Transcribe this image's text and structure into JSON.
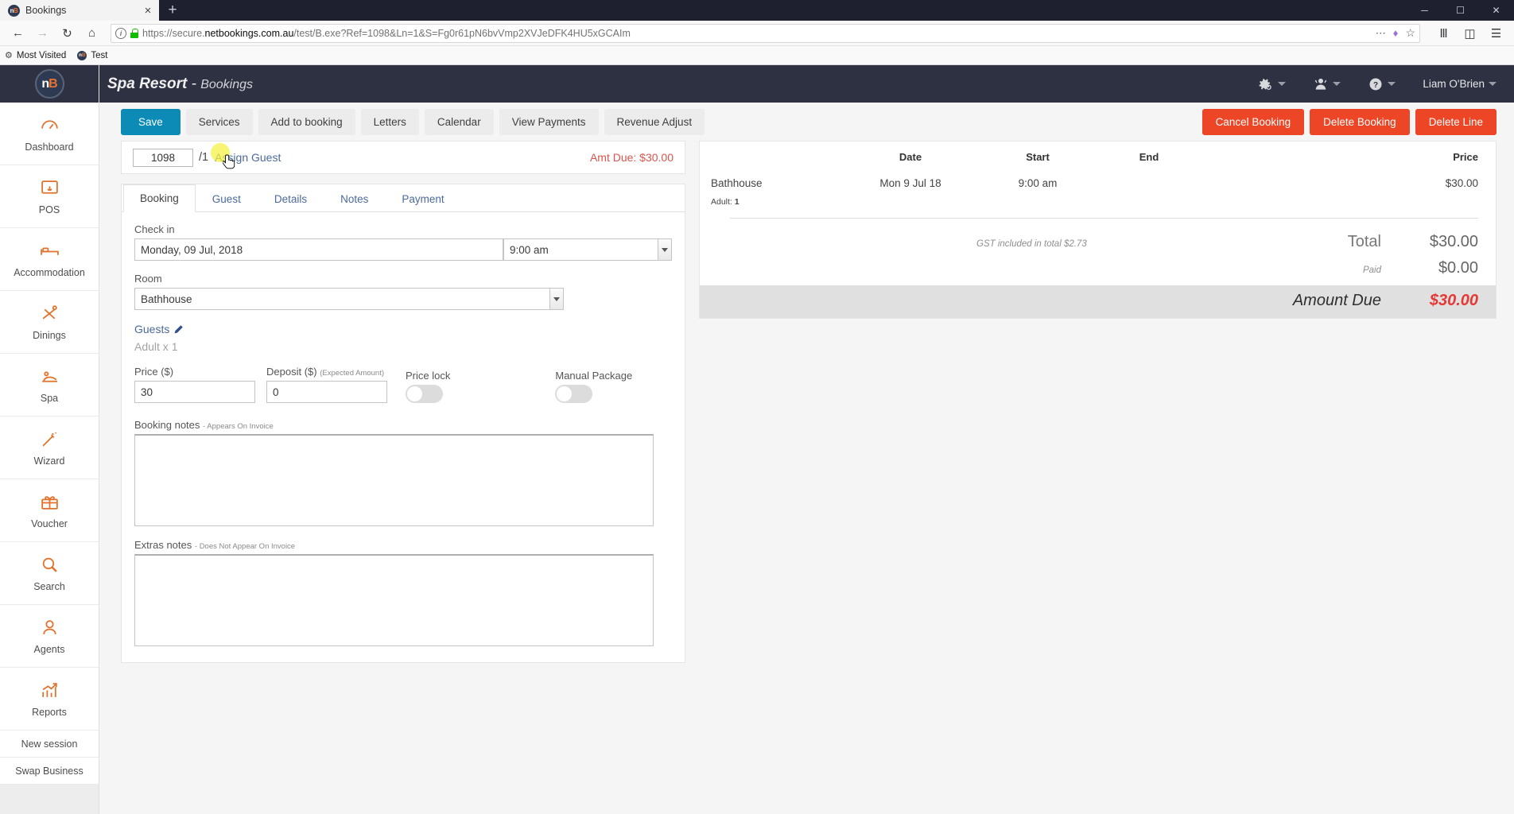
{
  "browser": {
    "tab_title": "Bookings",
    "favicon_text": "n",
    "favicon_accent": "B",
    "new_tab_glyph": "+",
    "close_glyph": "×",
    "url_prefix": "https://secure.",
    "url_domain": "netbookings.com.au",
    "url_suffix": "/test/B.exe?Ref=1098&Ln=1&S=Fg0r61pN6bvVmp2XVJeDFK4HU5xGCAIm",
    "window_minimize": "─",
    "window_maximize": "☐",
    "window_close": "✕",
    "bookmarks": [
      {
        "label": "Most Visited",
        "icon": "gear-icon"
      },
      {
        "label": "Test",
        "icon": "netbookings-favicon"
      }
    ]
  },
  "sidebar": {
    "logo": {
      "text": "n",
      "accent": "B"
    },
    "items": [
      {
        "label": "Dashboard",
        "icon": "gauge-icon"
      },
      {
        "label": "POS",
        "icon": "pos-terminal-icon"
      },
      {
        "label": "Accommodation",
        "icon": "bed-icon"
      },
      {
        "label": "Dinings",
        "icon": "cutlery-icon"
      },
      {
        "label": "Spa",
        "icon": "massage-icon"
      },
      {
        "label": "Wizard",
        "icon": "magic-wand-icon"
      },
      {
        "label": "Voucher",
        "icon": "gift-icon"
      },
      {
        "label": "Search",
        "icon": "magnifier-icon"
      },
      {
        "label": "Agents",
        "icon": "agent-person-icon"
      },
      {
        "label": "Reports",
        "icon": "bar-chart-icon"
      }
    ],
    "plain_items": [
      {
        "label": "New session"
      },
      {
        "label": "Swap Business"
      }
    ]
  },
  "header": {
    "business": "Spa Resort",
    "separator": "-",
    "section": "Bookings",
    "user": "Liam O'Brien",
    "menus": [
      {
        "name": "settings-menu",
        "icon": "gear-icon"
      },
      {
        "name": "user-menu",
        "icon": "person-icon"
      },
      {
        "name": "help-menu",
        "icon": "question-circle-icon"
      }
    ]
  },
  "toolbar": {
    "left_buttons": [
      {
        "label": "Save",
        "style": "primary"
      },
      {
        "label": "Services",
        "style": "default"
      },
      {
        "label": "Add to booking",
        "style": "default"
      },
      {
        "label": "Letters",
        "style": "default"
      },
      {
        "label": "Calendar",
        "style": "default"
      },
      {
        "label": "View Payments",
        "style": "default"
      },
      {
        "label": "Revenue Adjust",
        "style": "default"
      }
    ],
    "right_buttons": [
      {
        "label": "Cancel Booking",
        "style": "danger"
      },
      {
        "label": "Delete Booking",
        "style": "danger"
      },
      {
        "label": "Delete Line",
        "style": "danger"
      }
    ]
  },
  "refbar": {
    "booking_ref": "1098",
    "line_separator": "/1",
    "assign_guest_label": "Assign Guest",
    "amount_due_label": "Amt Due: $30.00"
  },
  "tabs": [
    {
      "label": "Booking",
      "active": true
    },
    {
      "label": "Guest",
      "active": false
    },
    {
      "label": "Details",
      "active": false
    },
    {
      "label": "Notes",
      "active": false
    },
    {
      "label": "Payment",
      "active": false
    }
  ],
  "form": {
    "checkin_label": "Check in",
    "checkin_date": "Monday, 09 Jul, 2018",
    "checkin_time": "9:00 am",
    "room_label": "Room",
    "room_value": "Bathhouse",
    "guests_label": "Guests",
    "guests_summary": "Adult x 1",
    "price_label": "Price ($)",
    "price_value": "30",
    "deposit_label": "Deposit ($)",
    "deposit_sub": "(Expected Amount)",
    "deposit_value": "0",
    "price_lock_label": "Price lock",
    "price_lock_on": false,
    "manual_package_label": "Manual Package",
    "manual_package_on": false,
    "booking_notes_label": "Booking notes",
    "booking_notes_sub": "- Appears On Invoice",
    "booking_notes_value": "",
    "extras_notes_label": "Extras notes",
    "extras_notes_sub": "- Does Not Appear On Invoice",
    "extras_notes_value": ""
  },
  "summary": {
    "columns": [
      "",
      "Date",
      "Start",
      "End",
      "Price"
    ],
    "rows": [
      {
        "item": "Bathhouse",
        "date": "Mon 9 Jul 18",
        "start": "9:00 am",
        "end": "",
        "price": "$30.00",
        "guests": "Adult:",
        "guests_count": "1"
      }
    ],
    "gst_note": "GST included in total $2.73",
    "total_label": "Total",
    "total_value": "$30.00",
    "paid_label": "Paid",
    "paid_value": "$0.00",
    "amount_due_label": "Amount Due",
    "amount_due_value": "$30.00"
  },
  "colors": {
    "accent_orange": "#e2712b",
    "primary_blue": "#0b8bb5",
    "danger_red": "#ec4627",
    "header_dark": "#2e3142",
    "due_red": "#e53935"
  }
}
